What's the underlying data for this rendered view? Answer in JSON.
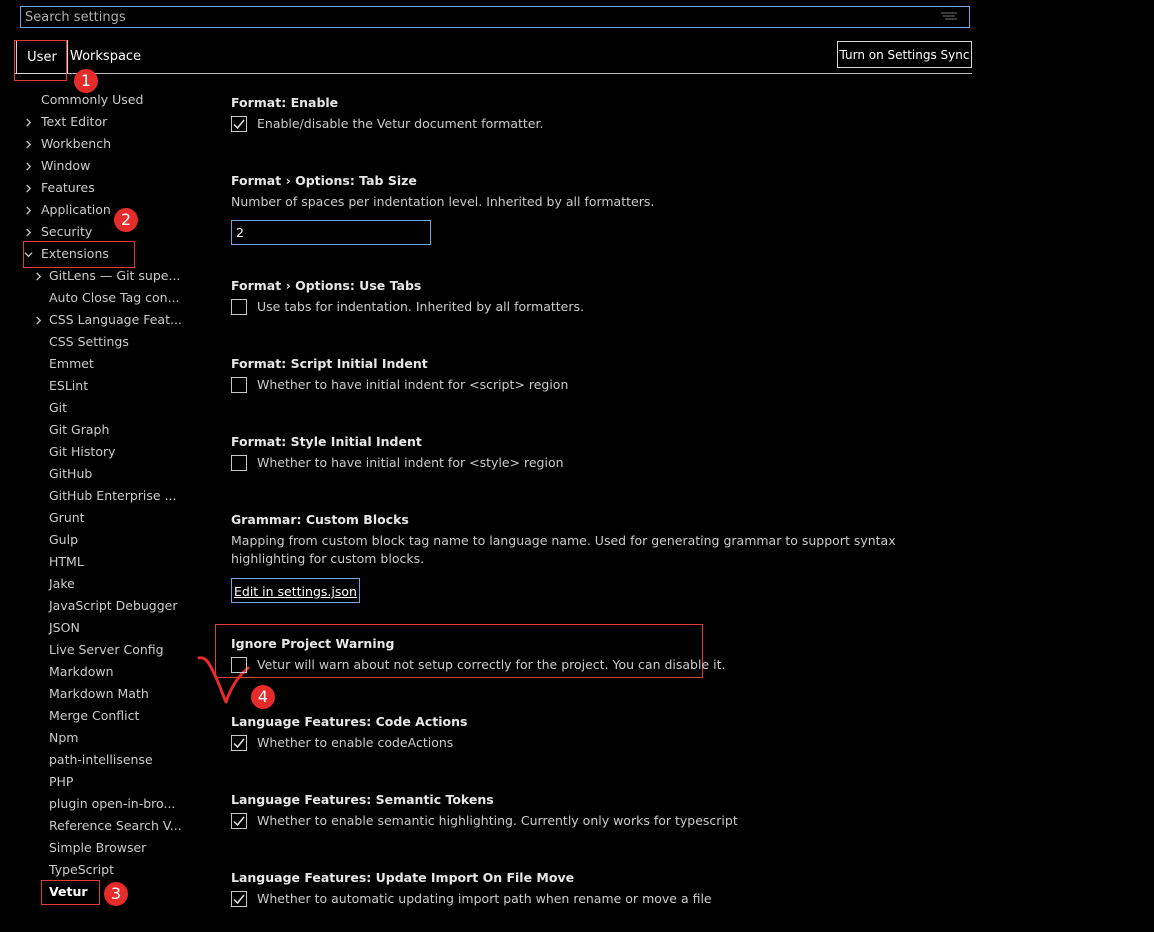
{
  "search": {
    "placeholder": "Search settings"
  },
  "tabs": {
    "user": "User",
    "workspace": "Workspace"
  },
  "sync_button": "Turn on Settings Sync",
  "toc": {
    "top": [
      {
        "label": "Commonly Used",
        "chevron": "none"
      },
      {
        "label": "Text Editor",
        "chevron": "right"
      },
      {
        "label": "Workbench",
        "chevron": "right"
      },
      {
        "label": "Window",
        "chevron": "right"
      },
      {
        "label": "Features",
        "chevron": "right"
      },
      {
        "label": "Application",
        "chevron": "right"
      },
      {
        "label": "Security",
        "chevron": "right"
      },
      {
        "label": "Extensions",
        "chevron": "down"
      }
    ],
    "extensions": [
      {
        "label": "GitLens — Git supe...",
        "chevron": "right"
      },
      {
        "label": "Auto Close Tag con...",
        "chevron": "none"
      },
      {
        "label": "CSS Language Feat...",
        "chevron": "right"
      },
      {
        "label": "CSS Settings",
        "chevron": "none"
      },
      {
        "label": "Emmet",
        "chevron": "none"
      },
      {
        "label": "ESLint",
        "chevron": "none"
      },
      {
        "label": "Git",
        "chevron": "none"
      },
      {
        "label": "Git Graph",
        "chevron": "none"
      },
      {
        "label": "Git History",
        "chevron": "none"
      },
      {
        "label": "GitHub",
        "chevron": "none"
      },
      {
        "label": "GitHub Enterprise ...",
        "chevron": "none"
      },
      {
        "label": "Grunt",
        "chevron": "none"
      },
      {
        "label": "Gulp",
        "chevron": "none"
      },
      {
        "label": "HTML",
        "chevron": "none"
      },
      {
        "label": "Jake",
        "chevron": "none"
      },
      {
        "label": "JavaScript Debugger",
        "chevron": "none"
      },
      {
        "label": "JSON",
        "chevron": "none"
      },
      {
        "label": "Live Server Config",
        "chevron": "none"
      },
      {
        "label": "Markdown",
        "chevron": "none"
      },
      {
        "label": "Markdown Math",
        "chevron": "none"
      },
      {
        "label": "Merge Conflict",
        "chevron": "none"
      },
      {
        "label": "Npm",
        "chevron": "none"
      },
      {
        "label": "path-intellisense",
        "chevron": "none"
      },
      {
        "label": "PHP",
        "chevron": "none"
      },
      {
        "label": "plugin open-in-bro...",
        "chevron": "none"
      },
      {
        "label": "Reference Search V...",
        "chevron": "none"
      },
      {
        "label": "Simple Browser",
        "chevron": "none"
      },
      {
        "label": "TypeScript",
        "chevron": "none"
      },
      {
        "label": "Vetur",
        "chevron": "none"
      }
    ]
  },
  "badges": [
    "1",
    "2",
    "3",
    "4"
  ],
  "settings": {
    "format_enable": {
      "title": "Format: Enable",
      "desc": "Enable/disable the Vetur document formatter.",
      "checked": true
    },
    "tab_size": {
      "title": "Format › Options: Tab Size",
      "desc": "Number of spaces per indentation level. Inherited by all formatters.",
      "value": "2"
    },
    "use_tabs": {
      "title": "Format › Options: Use Tabs",
      "desc": "Use tabs for indentation. Inherited by all formatters.",
      "checked": false
    },
    "script_indent": {
      "title": "Format: Script Initial Indent",
      "desc": "Whether to have initial indent for <script> region",
      "checked": false
    },
    "style_indent": {
      "title": "Format: Style Initial Indent",
      "desc": "Whether to have initial indent for <style> region",
      "checked": false
    },
    "custom_blocks": {
      "title": "Grammar: Custom Blocks",
      "desc": "Mapping from custom block tag name to language name. Used for generating grammar to support syntax highlighting for custom blocks.",
      "link": "Edit in settings.json"
    },
    "ignore_warning": {
      "title": "Ignore Project Warning",
      "desc": "Vetur will warn about not setup correctly for the project. You can disable it.",
      "checked": false
    },
    "code_actions": {
      "title": "Language Features: Code Actions",
      "desc": "Whether to enable codeActions",
      "checked": true
    },
    "semantic_tokens": {
      "title": "Language Features: Semantic Tokens",
      "desc": "Whether to enable semantic highlighting. Currently only works for typescript",
      "checked": true
    },
    "update_import": {
      "title": "Language Features: Update Import On File Move",
      "desc": "Whether to automatic updating import path when rename or move a file",
      "checked": true
    }
  },
  "colors": {
    "annotation_red": "#e23b3b",
    "badge_red": "#e62b2b",
    "focus_blue": "#6fa8dc"
  }
}
